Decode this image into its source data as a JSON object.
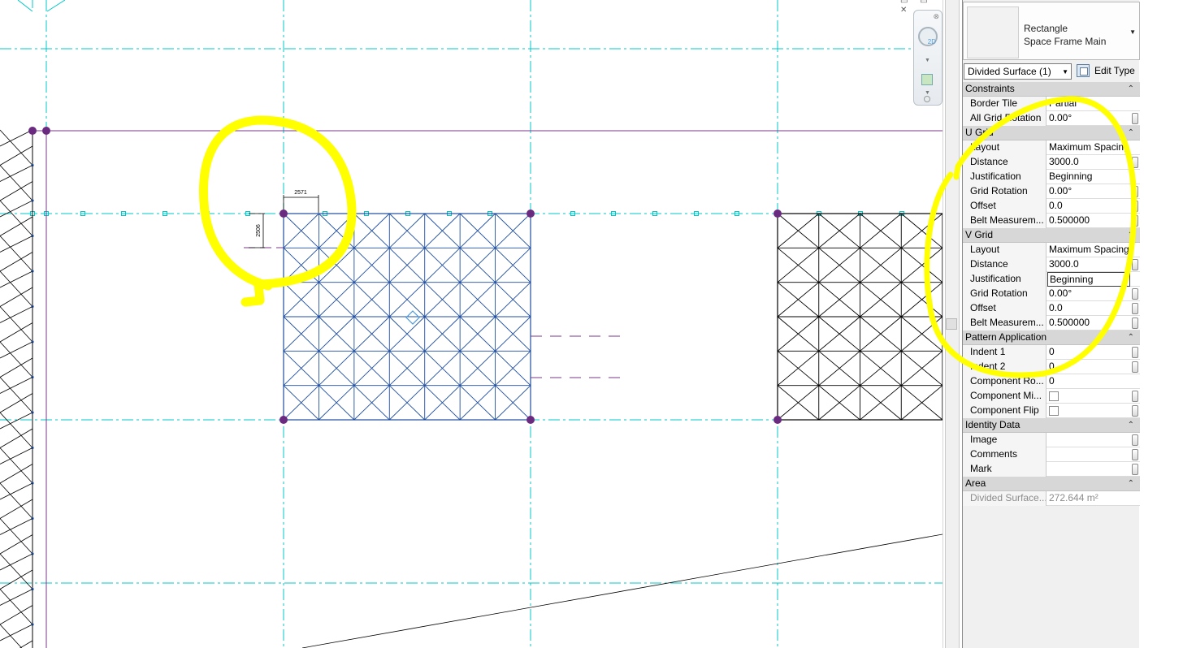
{
  "canvas": {
    "dimension_horizontal": "2571",
    "dimension_vertical": "2506"
  },
  "properties": {
    "type_family": "Rectangle",
    "type_name": "Space Frame Main",
    "instance_selector": "Divided Surface (1)",
    "edit_type_label": "Edit Type",
    "groups": [
      {
        "name": "Constraints",
        "rows": [
          {
            "label": "Border Tile",
            "value": "Partial"
          },
          {
            "label": "All Grid Rotation",
            "value": "0.00°"
          }
        ]
      },
      {
        "name": "U Grid",
        "rows": [
          {
            "label": "Layout",
            "value": "Maximum Spacing"
          },
          {
            "label": "Distance",
            "value": "3000.0"
          },
          {
            "label": "Justification",
            "value": "Beginning"
          },
          {
            "label": "Grid Rotation",
            "value": "0.00°"
          },
          {
            "label": "Offset",
            "value": "0.0"
          },
          {
            "label": "Belt Measurem...",
            "value": "0.500000"
          }
        ]
      },
      {
        "name": "V Grid",
        "rows": [
          {
            "label": "Layout",
            "value": "Maximum Spacing"
          },
          {
            "label": "Distance",
            "value": "3000.0"
          },
          {
            "label": "Justification",
            "value": "Beginning"
          },
          {
            "label": "Grid Rotation",
            "value": "0.00°"
          },
          {
            "label": "Offset",
            "value": "0.0"
          },
          {
            "label": "Belt Measurem...",
            "value": "0.500000"
          }
        ]
      },
      {
        "name": "Pattern Application",
        "rows": [
          {
            "label": "Indent 1",
            "value": "0"
          },
          {
            "label": "Indent 2",
            "value": "0"
          },
          {
            "label": "Component Ro...",
            "value": "0"
          },
          {
            "label": "Component Mi...",
            "value": ""
          },
          {
            "label": "Component Flip",
            "value": ""
          }
        ]
      },
      {
        "name": "Identity Data",
        "rows": [
          {
            "label": "Image",
            "value": ""
          },
          {
            "label": "Comments",
            "value": ""
          },
          {
            "label": "Mark",
            "value": ""
          }
        ]
      },
      {
        "name": "Area",
        "rows": [
          {
            "label": "Divided Surface...",
            "value": "272.644 m²"
          }
        ]
      }
    ]
  },
  "colors": {
    "grid_line": "#00c8c8",
    "reference_line": "#7a3a8a",
    "selected_pattern": "#1f4ea0",
    "pattern": "#000000",
    "highlight": "#ffff00",
    "grip": "#6a2a80"
  }
}
